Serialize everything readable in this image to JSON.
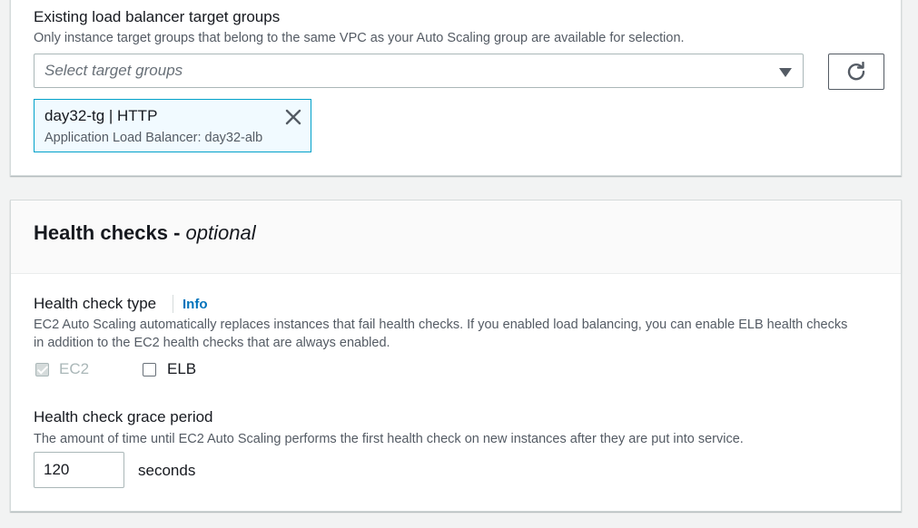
{
  "target_groups": {
    "label": "Existing load balancer target groups",
    "description": "Only instance target groups that belong to the same VPC as your Auto Scaling group are available for selection.",
    "select_placeholder": "Select target groups",
    "selected": [
      {
        "name": "day32-tg | HTTP",
        "detail": "Application Load Balancer: day32-alb"
      }
    ],
    "refresh_icon": "refresh-icon"
  },
  "health_checks": {
    "title": "Health checks - ",
    "title_optional": "optional",
    "type_label": "Health check type",
    "info_link": "Info",
    "type_description": "EC2 Auto Scaling automatically replaces instances that fail health checks. If you enabled load balancing, you can enable ELB health checks in addition to the EC2 health checks that are always enabled.",
    "options": [
      {
        "label": "EC2",
        "checked": true,
        "disabled": true
      },
      {
        "label": "ELB",
        "checked": false,
        "disabled": false
      }
    ],
    "grace_label": "Health check grace period",
    "grace_description": "The amount of time until EC2 Auto Scaling performs the first health check on new instances after they are put into service.",
    "grace_value": "120",
    "grace_unit": "seconds"
  },
  "colors": {
    "link": "#0073bb",
    "token_border": "#00a1c9",
    "token_bg": "#f1faff"
  }
}
